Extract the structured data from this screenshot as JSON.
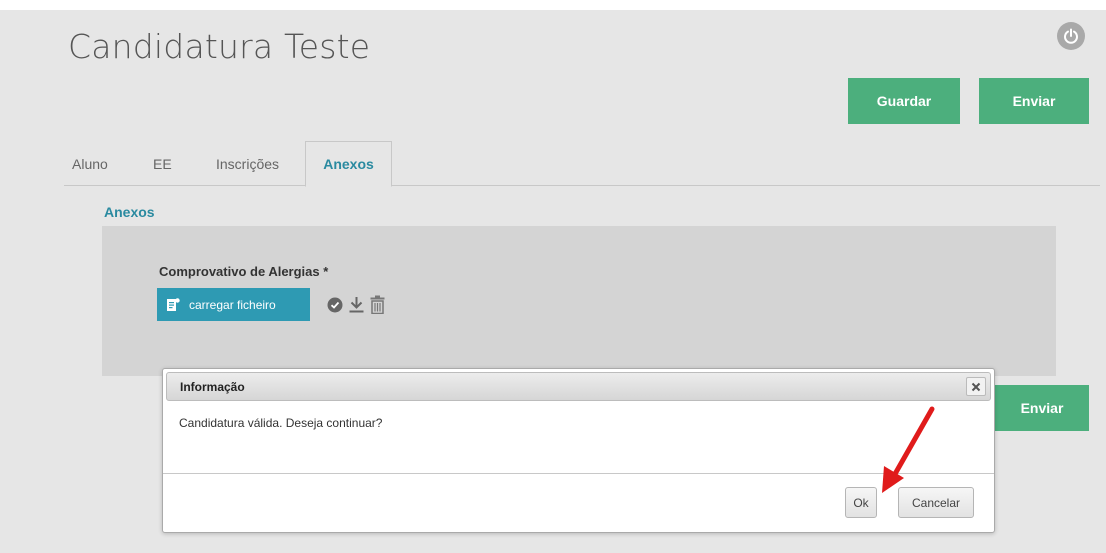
{
  "header": {
    "title": "Candidatura Teste",
    "power_icon": "power-icon"
  },
  "actions": {
    "save_label": "Guardar",
    "send_label": "Enviar"
  },
  "tabs": [
    {
      "label": "Aluno",
      "active": false
    },
    {
      "label": "EE",
      "active": false
    },
    {
      "label": "Inscrições",
      "active": false
    },
    {
      "label": "Anexos",
      "active": true
    }
  ],
  "attachments": {
    "section_title": "Anexos",
    "field_label": "Comprovativo de Alergias *",
    "upload_label": "carregar ficheiro",
    "icons": [
      "file-upload-icon",
      "check-circle-icon",
      "download-icon",
      "trash-icon"
    ]
  },
  "dialog": {
    "title": "Informação",
    "message": "Candidatura válida. Deseja continuar?",
    "ok_label": "Ok",
    "cancel_label": "Cancelar",
    "close_icon": "close-icon"
  },
  "colors": {
    "primary_green": "#4caf7d",
    "accent_teal": "#2a8aa0",
    "upload_blue": "#2e9ab3",
    "annotation_red": "#e01b1b",
    "page_background": "#e6e6e6"
  }
}
